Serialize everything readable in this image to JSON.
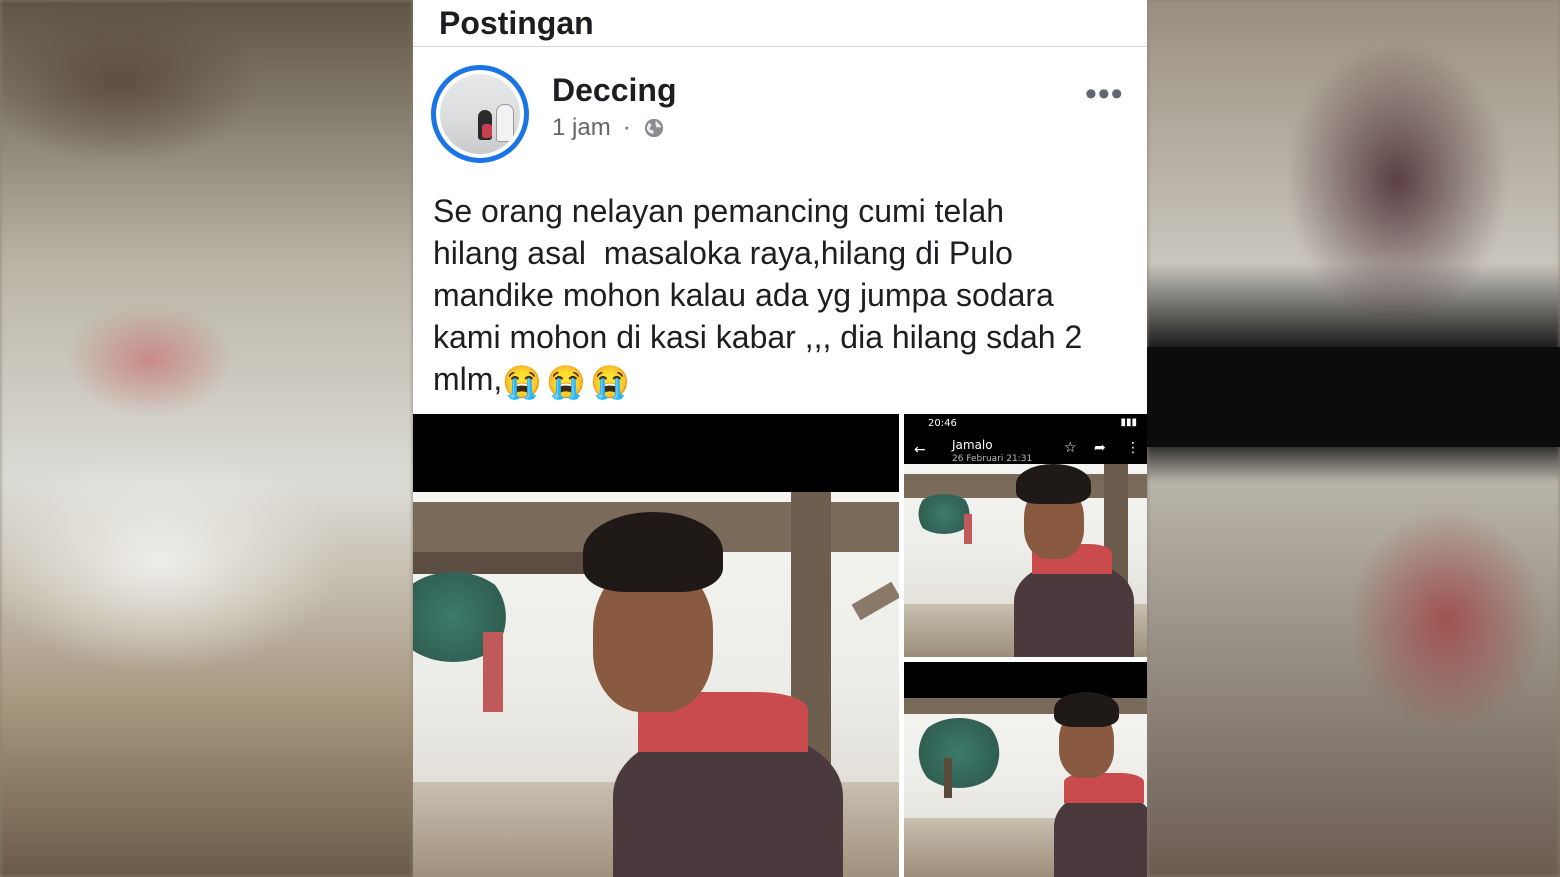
{
  "post_header": {
    "title": "Postingan"
  },
  "author": {
    "name": "Deccing",
    "time": "1 jam",
    "separator": "·"
  },
  "post": {
    "text": "Se orang nelayan pemancing cumi telah\nhilang asal  masaloka raya,hilang di Pulo\nmandike mohon kalau ada yg jumpa sodara\nkami mohon di kasi kabar ,,, dia hilang sdah 2\nmlm,",
    "emojis": [
      "😭",
      "😭",
      "😭"
    ]
  },
  "photo_tr": {
    "status_time": "20:46",
    "contact": "Jamalo",
    "date": "26 Februari 21:31"
  },
  "colors": {
    "accent": "#1b74e4",
    "text": "#1c1e21",
    "muted": "#65676b"
  },
  "icons": [
    "globe-icon",
    "more-options-icon"
  ]
}
